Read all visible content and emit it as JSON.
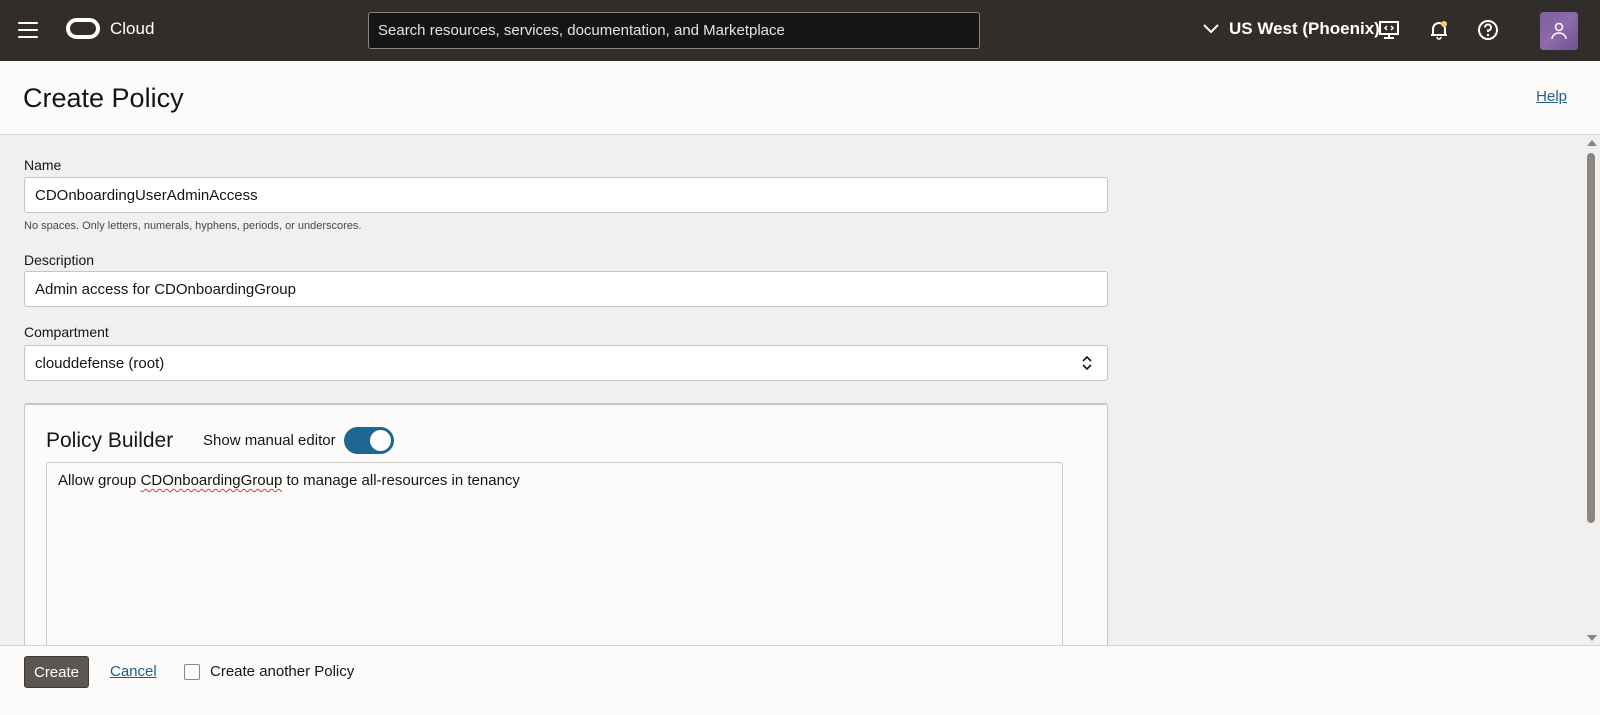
{
  "topbar": {
    "brand": "Cloud",
    "search_placeholder": "Search resources, services, documentation, and Marketplace",
    "region": "US West (Phoenix)",
    "icons": [
      "hamburger-menu-icon",
      "oracle-logo-icon",
      "chevron-down-icon",
      "developer-tools-icon",
      "bell-icon",
      "help-circle-icon",
      "user-avatar-icon"
    ]
  },
  "header": {
    "title": "Create Policy",
    "help": "Help"
  },
  "form": {
    "name": {
      "label": "Name",
      "value": "CDOnboardingUserAdminAccess",
      "hint": "No spaces. Only letters, numerals, hyphens, periods, or underscores."
    },
    "description": {
      "label": "Description",
      "value": "Admin access for CDOnboardingGroup"
    },
    "compartment": {
      "label": "Compartment",
      "value": "clouddefense (root)"
    },
    "policy_builder": {
      "title": "Policy Builder",
      "toggle_label": "Show manual editor",
      "toggle_on": true,
      "statement_prefix": "Allow group ",
      "statement_group": "CDOnboardingGroup",
      "statement_suffix": " to manage all-resources in tenancy"
    }
  },
  "footer": {
    "create": "Create",
    "cancel": "Cancel",
    "create_another": "Create another Policy",
    "create_another_checked": false
  },
  "colors": {
    "topbar_bg": "#312d2a",
    "toggle_on": "#1e6794",
    "link": "#1d5f8a",
    "primary_button": "#5b5652"
  }
}
